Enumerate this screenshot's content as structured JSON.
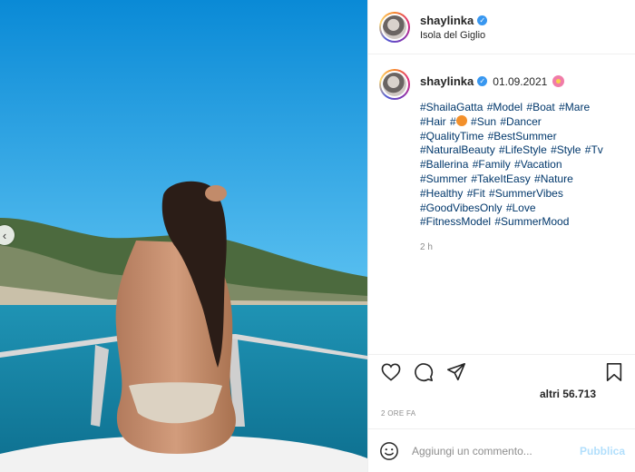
{
  "post": {
    "username": "shaylinka",
    "location": "Isola del Giglio",
    "date": "01.09.2021",
    "caption_tags_lines": [
      "#ShailaGatta #Model #Boat #Mare",
      "#Hair #",
      " #Sun #Dancer",
      "#QualityTime #BestSummer",
      "#NaturalBeauty #LifeStyle #Style #Tv",
      "#Ballerina #Family #Vacation",
      "#Summer #TakeItEasy #Nature",
      "#Healthy #Fit #SummerVibes",
      "#GoodVibesOnly #Love",
      "#FitnessModel #SummerMood"
    ],
    "comment_time": "2 h",
    "likes_text": "altri 56.713",
    "post_age": "2 ORE FA"
  },
  "comment": {
    "placeholder": "Aggiungi un commento...",
    "publish_label": "Pubblica"
  },
  "icons": {
    "prev": "chevron-left-icon",
    "like": "heart-icon",
    "comment": "comment-bubble-icon",
    "share": "paper-plane-icon",
    "save": "bookmark-icon",
    "emoji": "smiley-icon",
    "verified": "verified-badge-icon"
  },
  "colors": {
    "link": "#00376b",
    "muted": "#8e8e8e",
    "publish_disabled": "#b2dffc",
    "verified": "#3897f0"
  }
}
